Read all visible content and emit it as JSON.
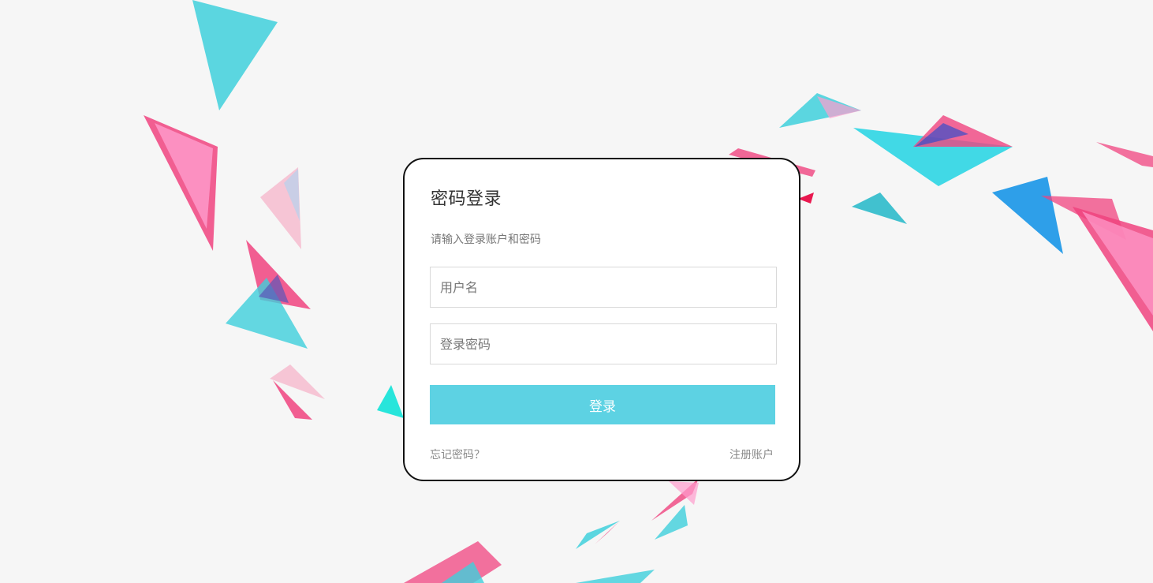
{
  "login": {
    "title": "密码登录",
    "subtitle": "请输入登录账户和密码",
    "username": {
      "placeholder": "用户名",
      "value": ""
    },
    "password": {
      "placeholder": "登录密码",
      "value": ""
    },
    "submit_label": "登录",
    "forgot_label": "忘记密码？",
    "register_label": "注册账户"
  },
  "colors": {
    "background": "#f6f6f6",
    "card_border": "#111111",
    "button": "#5dd2e3",
    "decor_cyan": "#3fd0dc",
    "decor_pink": "#f0437f",
    "decor_blue": "#0a8fe6"
  }
}
